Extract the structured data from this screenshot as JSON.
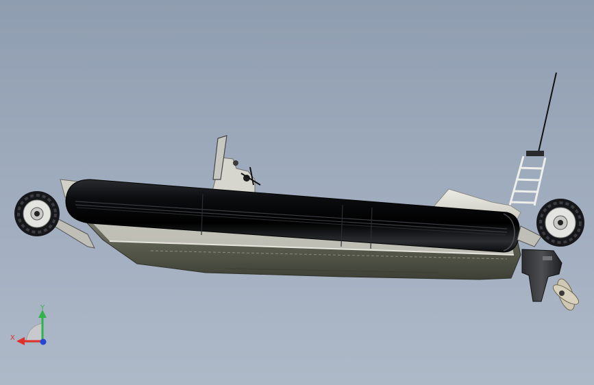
{
  "viewport": {
    "background_top": "#8f9db0",
    "background_bottom": "#aeb9c8"
  },
  "model": {
    "tube_color": "#0d0e10",
    "hull_color": "#5d6052",
    "deck_color": "#d8d8cf",
    "wheel_color": "#e6e7e3",
    "tire_color": "#15161a"
  },
  "triad": {
    "x_label": "X",
    "y_label": "Y",
    "x_color": "#e0302b",
    "y_color": "#2fb44a",
    "z_color": "#2545d6"
  }
}
